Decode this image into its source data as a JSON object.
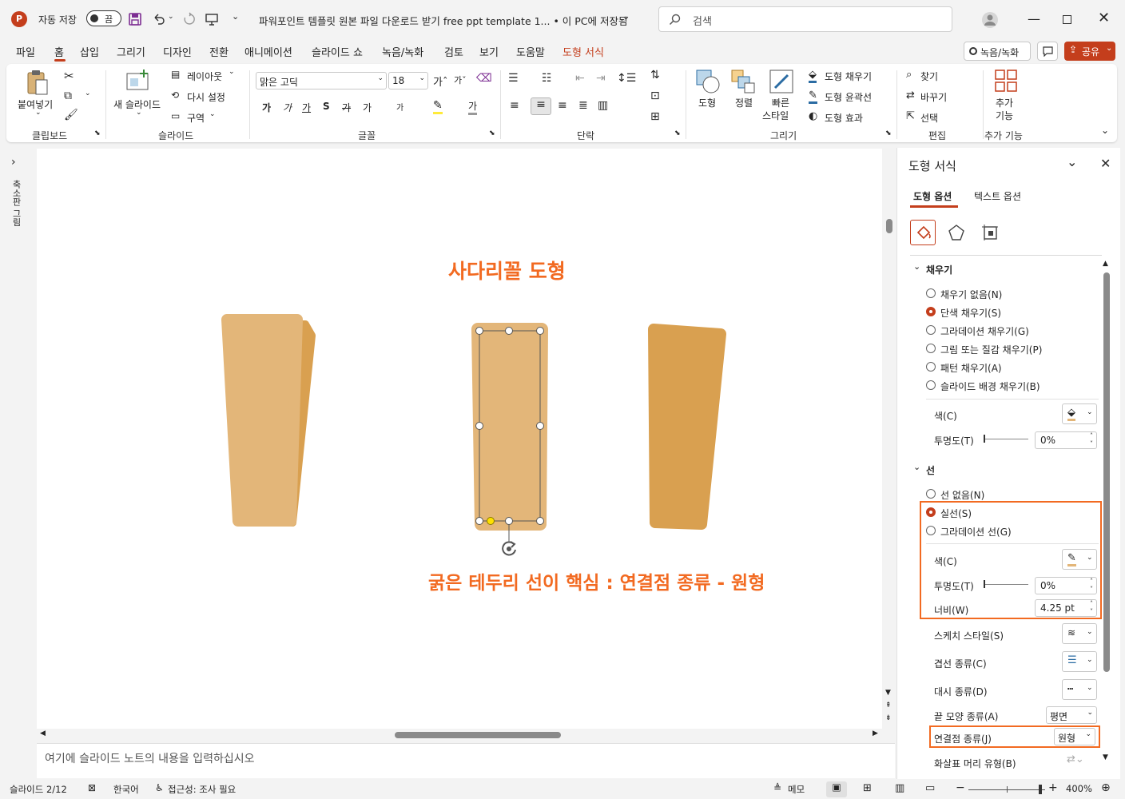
{
  "titlebar": {
    "autosave_label": "자동 저장",
    "autosave_state": "끔",
    "doc_title": "파워포인트 템플릿 원본 파일 다운로드 받기 free ppt template 1... • 이 PC에 저장됨",
    "search_placeholder": "검색"
  },
  "menu": {
    "items": [
      "파일",
      "홈",
      "삽입",
      "그리기",
      "디자인",
      "전환",
      "애니메이션",
      "슬라이드 쇼",
      "녹음/녹화",
      "검토",
      "보기",
      "도움말",
      "도형 서식"
    ],
    "record_button": "녹음/녹화",
    "share_button": "공유"
  },
  "ribbon": {
    "paste": "붙여넣기",
    "clipboard_group": "클립보드",
    "new_slide": "새 슬라이드",
    "layout": "레이아웃",
    "reset": "다시 설정",
    "section": "구역",
    "slides_group": "슬라이드",
    "font_name": "맑은 고딕",
    "font_size": "18",
    "font_group": "글꼴",
    "paragraph_group": "단락",
    "shape": "도형",
    "arrange": "정렬",
    "quick_style_1": "빠른",
    "quick_style_2": "스타일",
    "shape_fill": "도형 채우기",
    "shape_outline": "도형 윤곽선",
    "shape_effects": "도형 효과",
    "drawing_group": "그리기",
    "find": "찾기",
    "replace": "바꾸기",
    "select": "선택",
    "editing_group": "편집",
    "addins_1": "추가",
    "addins_2": "기능",
    "addins_group": "추가 기능",
    "font_buttons": [
      "가",
      "가",
      "가",
      "S",
      "가",
      "가",
      "가",
      "가"
    ]
  },
  "leftrail": {
    "label": "축소판 그림"
  },
  "slide": {
    "title": "사다리꼴 도형",
    "caption": "굵은 테두리 선이 핵심 : 연결점 종류 - 원형",
    "shape_color_light": "#e3b679",
    "shape_color_dark": "#d9a050",
    "accent": "#f26a21"
  },
  "notes": {
    "placeholder": "여기에 슬라이드 노트의 내용을 입력하십시오"
  },
  "pane": {
    "title": "도형 서식",
    "tab_shape": "도형 옵션",
    "tab_text": "텍스트 옵션",
    "fill_section": "채우기",
    "fill_options": [
      "채우기 없음(N)",
      "단색 채우기(S)",
      "그라데이션 채우기(G)",
      "그림 또는 질감 채우기(P)",
      "패턴 채우기(A)",
      "슬라이드 배경 채우기(B)"
    ],
    "fill_selected": 1,
    "fill_color_label": "색(C)",
    "fill_transparency_label": "투명도(T)",
    "fill_transparency": "0%",
    "line_section": "선",
    "line_options": [
      "선 없음(N)",
      "실선(S)",
      "그라데이션 선(G)"
    ],
    "line_selected": 1,
    "line_color_label": "색(C)",
    "line_transparency_label": "투명도(T)",
    "line_transparency": "0%",
    "width_label": "너비(W)",
    "width_value": "4.25 pt",
    "sketch_label": "스케치 스타일(S)",
    "compound_label": "겹선 종류(C)",
    "dash_label": "대시 종류(D)",
    "cap_label": "끝 모양 종류(A)",
    "cap_value": "평면",
    "join_label": "연결점 종류(J)",
    "join_value": "원형",
    "arrow_label": "화살표 머리 유형(B)"
  },
  "status": {
    "slide_info": "슬라이드 2/12",
    "language": "한국어",
    "accessibility": "접근성: 조사 필요",
    "notes_btn": "메모",
    "zoom": "400%"
  }
}
